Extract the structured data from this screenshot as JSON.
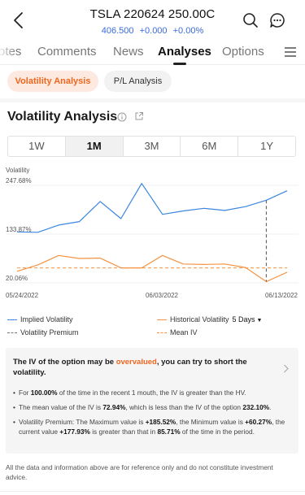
{
  "header": {
    "title": "TSLA 220624 250.00C",
    "price": "406.500",
    "change": "+0.000",
    "change_pct": "+0.00%",
    "icons": [
      "back-chevron-icon",
      "search-icon",
      "chat-bubble-icon"
    ],
    "quote_color": "#3b6bdc"
  },
  "tabs": {
    "items": [
      {
        "label": "otes"
      },
      {
        "label": "Comments"
      },
      {
        "label": "News"
      },
      {
        "label": "Analyses"
      },
      {
        "label": "Options"
      }
    ],
    "active": "Analyses",
    "menu_icon": "hamburger-menu-icon"
  },
  "pills": {
    "volatility": "Volatility Analysis",
    "pl": "P/L Analysis",
    "accent": "#f0661e"
  },
  "section": {
    "title": "Volatility Analysis",
    "icons": [
      "info-circle-icon",
      "share-icon"
    ]
  },
  "periods": {
    "items": [
      "1W",
      "1M",
      "3M",
      "6M",
      "1Y"
    ],
    "active": "1M"
  },
  "chart_data": {
    "type": "line",
    "ylabel": "Volatility",
    "y_ticks": [
      "247.68%",
      "133.87%",
      "20.06%"
    ],
    "x_ticks": [
      "05/24/2022",
      "06/03/2022",
      "06/13/2022"
    ],
    "grid": true,
    "ylim": [
      20.06,
      247.68
    ],
    "series": [
      {
        "name": "Implied Volatility",
        "color": "#3b86e0",
        "values": [
          139,
          138,
          155,
          163,
          210,
          170,
          252,
          180,
          188,
          194,
          189,
          198,
          213,
          235
        ]
      },
      {
        "name": "Historical Volatility",
        "color": "#f59342",
        "values": [
          47,
          62,
          84,
          77,
          78,
          55,
          55,
          84,
          64,
          63,
          64,
          56,
          23,
          45
        ]
      },
      {
        "name": "Mean IV",
        "color": "#f59342",
        "values": [
          55,
          55,
          55,
          55,
          55,
          55,
          55,
          55,
          55,
          55,
          55,
          55,
          55,
          55
        ]
      }
    ],
    "highlight_index": 12,
    "legend": {
      "implied": "Implied Volatility",
      "historical": "Historical Volatility",
      "hv_period": "5 Days",
      "premium": "Volatility Premium",
      "mean": "Mean IV"
    }
  },
  "insight": {
    "head_pre": "The IV of the option may be ",
    "head_flag": "overvalued",
    "head_post": ", you can try to short the volatility.",
    "b1_pre": "For ",
    "b1_v1": "100.00%",
    "b1_post": " of the time in the recent 1 mouth, the IV is greater than the HV.",
    "b2_pre": "The mean value of the IV is ",
    "b2_v1": "72.94%",
    "b2_mid": ", which is less than the IV of the option ",
    "b2_v2": "232.10%",
    "b2_post": ".",
    "b3_pre": "Volatility Premium: The Maximum value is ",
    "b3_v1": "+185.52%",
    "b3_mid1": ", the Minimum value is ",
    "b3_v2": "+60.27%",
    "b3_mid2": ", the current value ",
    "b3_v3": "+177.93%",
    "b3_mid3": " is greater than that in ",
    "b3_v4": "85.71%",
    "b3_post": " of the time in the period."
  },
  "disclaimer": "All the data and information above are for reference only and do not constitute investment advice."
}
